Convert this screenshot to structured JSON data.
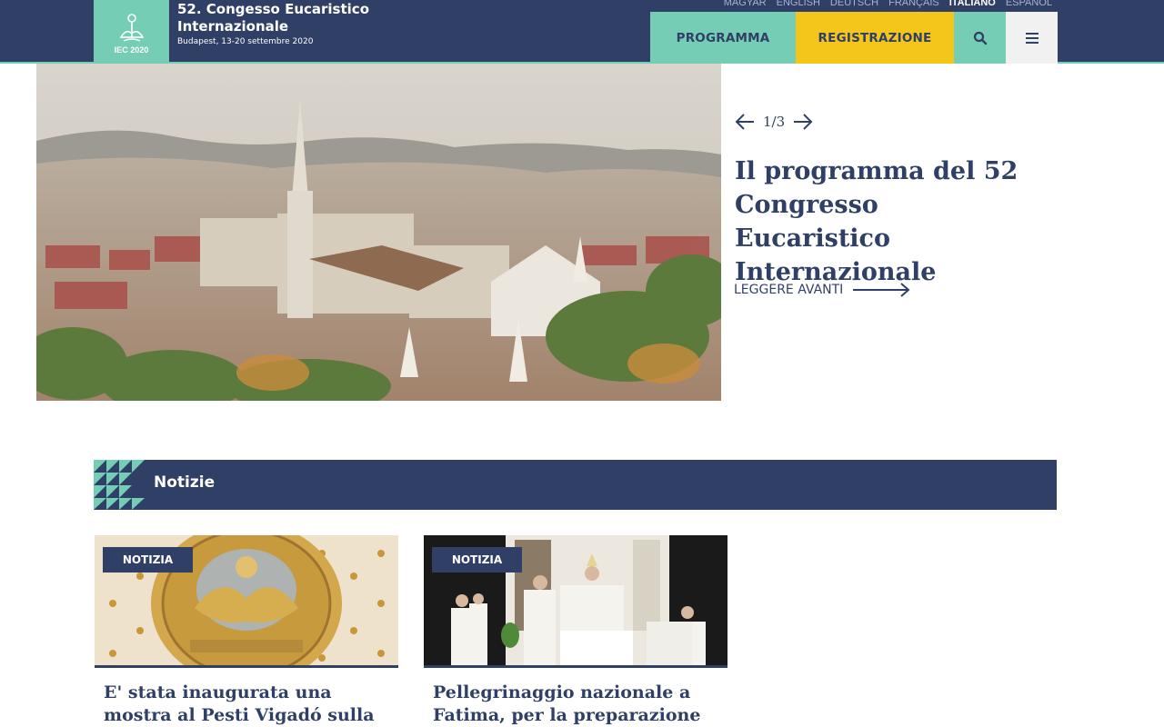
{
  "header": {
    "logo_text": "IEC 2020",
    "site_title": "52. Congesso Eucaristico Internazionale",
    "site_subtitle": "Budapest, 13-20 settembre 2020",
    "languages": [
      {
        "label": "MAGYAR",
        "active": false
      },
      {
        "label": "ENGLISH",
        "active": false
      },
      {
        "label": "DEUTSCH",
        "active": false
      },
      {
        "label": "FRANÇAIS",
        "active": false
      },
      {
        "label": "ITALIANO",
        "active": true
      },
      {
        "label": "ESPAÑOL",
        "active": false
      }
    ],
    "nav": {
      "programma": "PROGRAMMA",
      "registrazione": "REGISTRAZIONE"
    }
  },
  "hero": {
    "slide_counter": "1/3",
    "title": "Il programma del 52 Congresso Eucaristico Internazionale",
    "read_more": "LEGGERE AVANTI"
  },
  "news": {
    "section_title": "Notizie",
    "cards": [
      {
        "badge": "NOTIZIA",
        "title": "E' stata inaugurata una mostra al Pesti Vigadó sulla"
      },
      {
        "badge": "NOTIZIA",
        "title": "Pellegrinaggio nazionale a Fatima, per la preparazione al"
      }
    ]
  },
  "colors": {
    "navy": "#2f3f66",
    "teal": "#74cdb4",
    "yellow": "#f4c51a"
  },
  "icons": {
    "search": "search-icon",
    "menu": "hamburger-menu-icon",
    "prev": "arrow-left-icon",
    "next": "arrow-right-icon"
  }
}
